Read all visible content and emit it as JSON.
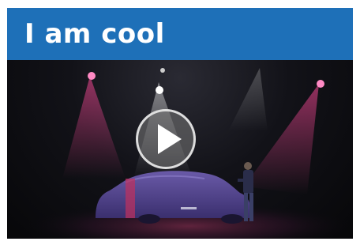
{
  "header": {
    "title": "I am cool"
  },
  "video": {
    "play_icon": "play-icon",
    "accent_color": "#1e70b8"
  }
}
